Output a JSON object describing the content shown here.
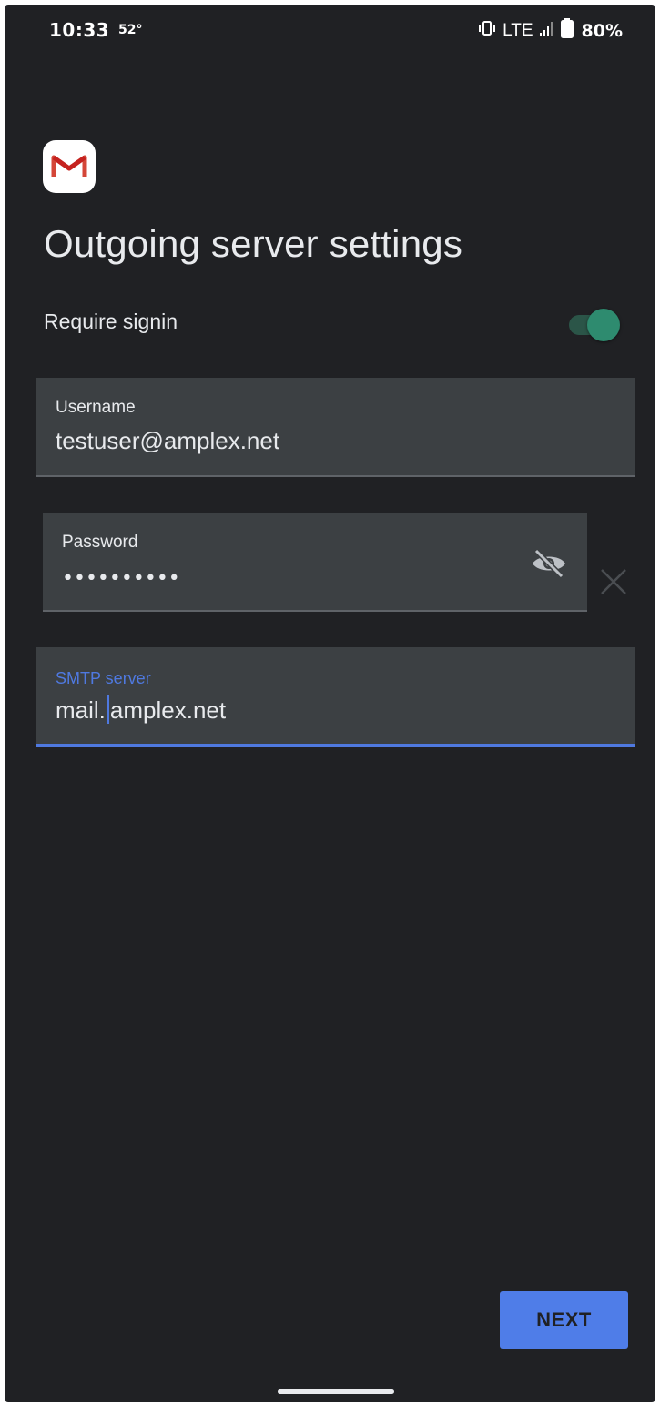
{
  "status_bar": {
    "time": "10:33",
    "temperature": "52°",
    "network": "LTE",
    "battery": "80%",
    "icons": [
      "vibrate-icon",
      "signal-icon",
      "battery-icon"
    ]
  },
  "app": {
    "logo": "gmail-logo"
  },
  "page": {
    "title": "Outgoing server settings"
  },
  "require_signin": {
    "label": "Require signin",
    "enabled": true
  },
  "fields": {
    "username": {
      "label": "Username",
      "value": "testuser@amplex.net"
    },
    "password": {
      "label": "Password",
      "value": "••••••••••",
      "toggle_icon": "visibility-off-icon"
    },
    "smtp": {
      "label": "SMTP server",
      "value_before_cursor": "mail.",
      "value_after_cursor": "amplex.net"
    }
  },
  "actions": {
    "next_label": "NEXT"
  },
  "colors": {
    "background": "#202124",
    "field_bg": "#3c4043",
    "accent": "#4f79e0",
    "toggle_on": "#2e8b6f",
    "button": "#4f7de8"
  }
}
